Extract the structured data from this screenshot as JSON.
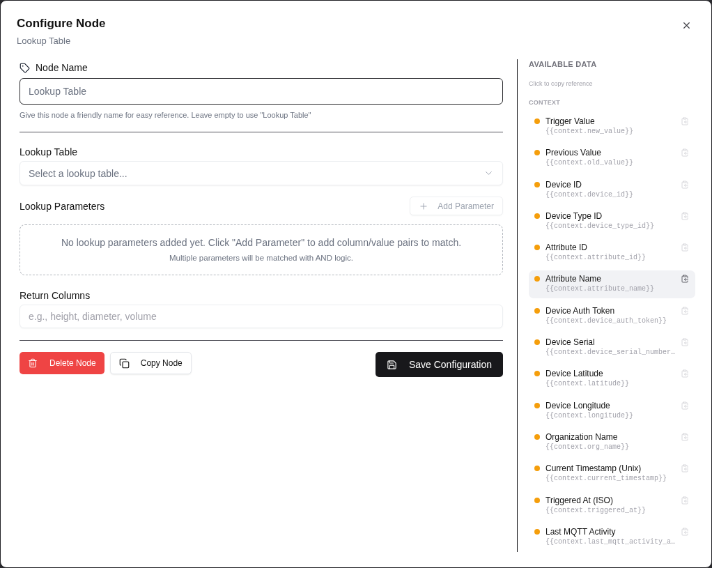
{
  "dialog": {
    "title": "Configure Node",
    "subtitle": "Lookup Table"
  },
  "form": {
    "node_name": {
      "label": "Node Name",
      "placeholder": "Lookup Table",
      "focused": true,
      "help": "Give this node a friendly name for easy reference. Leave empty to use \"Lookup Table\""
    },
    "lookup_table": {
      "label": "Lookup Table",
      "placeholder": "Select a lookup table..."
    },
    "parameters": {
      "label": "Lookup Parameters",
      "add_button": {
        "label": "Add Parameter",
        "disabled": true
      },
      "empty_message": "No lookup parameters added yet. Click \"Add Parameter\" to add column/value pairs to match.",
      "empty_hint": "Multiple parameters will be matched with AND logic."
    },
    "return_columns": {
      "label": "Return Columns",
      "placeholder": "e.g., height, diameter, volume"
    },
    "actions": [
      {
        "kind": "delete",
        "label": "Delete Node"
      },
      {
        "kind": "copy",
        "label": "Copy Node"
      },
      {
        "kind": "save",
        "label": "Save Configuration"
      }
    ]
  },
  "sidebar": {
    "title": "AVAILABLE DATA",
    "hint": "Click to copy reference",
    "groups": [
      {
        "title": "CONTEXT",
        "items": [
          {
            "label": "Trigger Value",
            "reference": "{{context.new_value}}",
            "highlighted": false
          },
          {
            "label": "Previous Value",
            "reference": "{{context.old_value}}",
            "highlighted": false
          },
          {
            "label": "Device ID",
            "reference": "{{context.device_id}}",
            "highlighted": false
          },
          {
            "label": "Device Type ID",
            "reference": "{{context.device_type_id}}",
            "highlighted": false
          },
          {
            "label": "Attribute ID",
            "reference": "{{context.attribute_id}}",
            "highlighted": false
          },
          {
            "label": "Attribute Name",
            "reference": "{{context.attribute_name}}",
            "highlighted": true
          },
          {
            "label": "Device Auth Token",
            "reference": "{{context.device_auth_token}}",
            "highlighted": false
          },
          {
            "label": "Device Serial",
            "reference": "{{context.device_serial_number…",
            "highlighted": false
          },
          {
            "label": "Device Latitude",
            "reference": "{{context.latitude}}",
            "highlighted": false
          },
          {
            "label": "Device Longitude",
            "reference": "{{context.longitude}}",
            "highlighted": false
          },
          {
            "label": "Organization Name",
            "reference": "{{context.org_name}}",
            "highlighted": false
          },
          {
            "label": "Current Timestamp (Unix)",
            "reference": "{{context.current_timestamp}}",
            "highlighted": false
          },
          {
            "label": "Triggered At (ISO)",
            "reference": "{{context.triggered_at}}",
            "highlighted": false
          },
          {
            "label": "Last MQTT Activity",
            "reference": "{{context.last_mqtt_activity_a…",
            "highlighted": false
          }
        ]
      }
    ]
  }
}
